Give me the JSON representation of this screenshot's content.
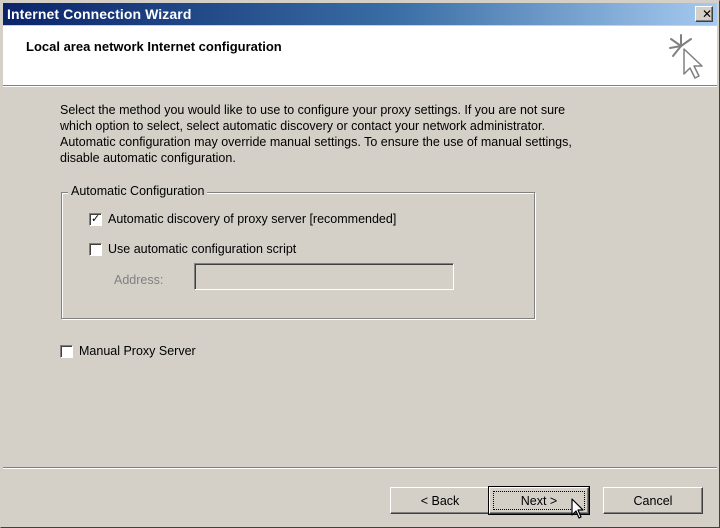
{
  "window": {
    "title": "Internet Connection Wizard",
    "close_glyph": "✕"
  },
  "header": {
    "title": "Local area network Internet configuration",
    "icon": "wizard-sparkle-cursor-icon"
  },
  "instructions": "Select the method you would like to use to configure your proxy settings.  If you are not sure\nwhich option to select, select automatic discovery or contact your network administrator.\nAutomatic configuration may override manual settings.  To ensure the use of manual settings,\ndisable automatic configuration.",
  "auto_config": {
    "legend": "Automatic Configuration",
    "auto_discovery": {
      "label": "Automatic discovery of proxy server [recommended]",
      "checked": true,
      "tick": "✓"
    },
    "auto_script": {
      "label": "Use automatic configuration script",
      "checked": false
    },
    "address": {
      "label": "Address:",
      "value": "",
      "enabled": false
    }
  },
  "manual_proxy": {
    "label": "Manual Proxy Server",
    "checked": false
  },
  "buttons": {
    "back": "< Back",
    "next": "Next >",
    "cancel": "Cancel"
  },
  "colors": {
    "face": "#d4d0c8",
    "title_start": "#0a246a",
    "title_end": "#a6caf0"
  }
}
